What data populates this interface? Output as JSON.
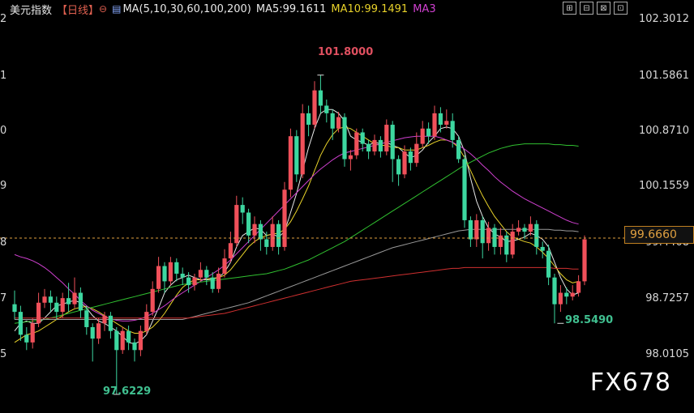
{
  "header": {
    "title": "美元指数",
    "period": "【日线】",
    "ma_label": "MA(5,10,30,60,100,200)",
    "ma5": "MA5:99.1611",
    "ma10": "MA10:99.1491",
    "ma3": "MA3"
  },
  "toolbar": [
    "⊞",
    "⊟",
    "⊠",
    "⊡"
  ],
  "colors": {
    "up": "#f0505a",
    "down": "#3dd7a0",
    "ma5": "#e8e8e8",
    "ma10": "#e8d22a",
    "ma30": "#d040d0",
    "ma60": "#30c030",
    "ma100": "#999999",
    "ma200": "#d03030",
    "current": "#e0a040",
    "high_label": "#e05060",
    "low_label": "#40c090"
  },
  "chart_data": {
    "type": "candlestick",
    "y_ticks": [
      "102.3012",
      "101.5861",
      "100.8710",
      "100.1559",
      "99.4408",
      "98.7257",
      "98.0105"
    ],
    "left_ticks": [
      "2",
      "1",
      "0",
      "9",
      "8",
      "7",
      "5"
    ],
    "current_price": "99.6660",
    "annotations": {
      "high": "101.8000",
      "low_left": "97.6229",
      "low_right": "98.5490"
    },
    "ylim": [
      97.8,
      102.55
    ],
    "candles": [
      [
        98.8,
        98.7,
        98.98,
        98.6
      ],
      [
        98.7,
        98.4,
        98.78,
        98.32
      ],
      [
        98.4,
        98.3,
        98.5,
        98.2
      ],
      [
        98.3,
        98.55,
        98.62,
        98.22
      ],
      [
        98.55,
        98.82,
        98.95,
        98.5
      ],
      [
        98.82,
        98.9,
        99.0,
        98.75
      ],
      [
        98.9,
        98.82,
        98.98,
        98.7
      ],
      [
        98.82,
        98.7,
        98.9,
        98.6
      ],
      [
        98.7,
        98.88,
        98.95,
        98.62
      ],
      [
        98.88,
        98.8,
        99.08,
        98.7
      ],
      [
        98.8,
        98.95,
        99.15,
        98.75
      ],
      [
        98.95,
        98.72,
        99.02,
        98.62
      ],
      [
        98.72,
        98.5,
        98.78,
        98.4
      ],
      [
        98.5,
        98.35,
        98.55,
        98.05
      ],
      [
        98.35,
        98.55,
        98.62,
        98.28
      ],
      [
        98.55,
        98.65,
        98.7,
        98.45
      ],
      [
        98.65,
        98.45,
        98.7,
        98.35
      ],
      [
        98.45,
        98.2,
        98.5,
        97.62
      ],
      [
        98.2,
        98.45,
        98.5,
        98.15
      ],
      [
        98.45,
        98.3,
        98.52,
        98.2
      ],
      [
        98.3,
        98.2,
        98.35,
        98.05
      ],
      [
        98.2,
        98.45,
        98.52,
        98.12
      ],
      [
        98.45,
        98.7,
        98.8,
        98.4
      ],
      [
        98.7,
        99.0,
        99.1,
        98.65
      ],
      [
        99.0,
        99.3,
        99.42,
        98.95
      ],
      [
        99.3,
        99.1,
        99.35,
        98.95
      ],
      [
        99.1,
        99.35,
        99.42,
        99.05
      ],
      [
        99.35,
        99.2,
        99.4,
        99.1
      ],
      [
        99.2,
        99.15,
        99.28,
        99.05
      ],
      [
        99.15,
        99.05,
        99.22,
        98.95
      ],
      [
        99.05,
        99.15,
        99.2,
        98.98
      ],
      [
        99.15,
        99.25,
        99.35,
        99.1
      ],
      [
        99.25,
        99.15,
        99.3,
        99.05
      ],
      [
        99.15,
        99.0,
        99.22,
        98.95
      ],
      [
        99.0,
        99.2,
        99.28,
        98.95
      ],
      [
        99.2,
        99.4,
        99.52,
        99.15
      ],
      [
        99.4,
        99.6,
        99.75,
        99.35
      ],
      [
        99.6,
        100.1,
        100.22,
        99.55
      ],
      [
        100.1,
        100.0,
        100.2,
        99.85
      ],
      [
        100.0,
        99.7,
        100.05,
        99.6
      ],
      [
        99.7,
        99.85,
        99.95,
        99.6
      ],
      [
        99.85,
        99.65,
        99.9,
        99.5
      ],
      [
        99.65,
        99.55,
        99.75,
        99.45
      ],
      [
        99.55,
        99.85,
        99.95,
        99.5
      ],
      [
        99.85,
        99.55,
        99.9,
        99.45
      ],
      [
        99.55,
        100.3,
        100.4,
        99.5
      ],
      [
        100.3,
        101.0,
        101.1,
        100.2
      ],
      [
        101.0,
        100.5,
        101.08,
        100.4
      ],
      [
        100.5,
        101.3,
        101.42,
        100.45
      ],
      [
        101.3,
        101.15,
        101.4,
        101.0
      ],
      [
        101.15,
        101.6,
        101.72,
        101.1
      ],
      [
        101.6,
        101.4,
        101.8,
        101.3
      ],
      [
        101.4,
        101.3,
        101.48,
        101.18
      ],
      [
        101.3,
        101.1,
        101.35,
        100.95
      ],
      [
        101.1,
        101.25,
        101.32,
        101.05
      ],
      [
        101.25,
        100.7,
        101.3,
        100.6
      ],
      [
        100.7,
        100.75,
        100.82,
        100.55
      ],
      [
        100.75,
        101.05,
        101.1,
        100.7
      ],
      [
        101.05,
        100.9,
        101.1,
        100.8
      ],
      [
        100.9,
        100.8,
        100.95,
        100.7
      ],
      [
        100.8,
        100.95,
        101.02,
        100.75
      ],
      [
        100.95,
        100.8,
        101.0,
        100.72
      ],
      [
        100.8,
        101.15,
        101.22,
        100.75
      ],
      [
        101.15,
        100.7,
        101.2,
        100.4
      ],
      [
        100.7,
        100.5,
        100.75,
        100.35
      ],
      [
        100.5,
        100.8,
        100.88,
        100.45
      ],
      [
        100.8,
        100.65,
        100.85,
        100.55
      ],
      [
        100.65,
        100.9,
        101.05,
        100.6
      ],
      [
        100.9,
        101.1,
        101.2,
        100.85
      ],
      [
        101.1,
        101.0,
        101.18,
        100.9
      ],
      [
        101.0,
        101.3,
        101.4,
        100.95
      ],
      [
        101.3,
        101.15,
        101.38,
        101.05
      ],
      [
        101.15,
        101.2,
        101.35,
        101.1
      ],
      [
        101.2,
        100.95,
        101.3,
        100.85
      ],
      [
        100.95,
        100.7,
        101.0,
        100.65
      ],
      [
        100.7,
        99.9,
        100.75,
        99.8
      ],
      [
        99.9,
        99.65,
        99.95,
        99.55
      ],
      [
        99.65,
        99.9,
        99.98,
        99.55
      ],
      [
        99.9,
        99.6,
        99.95,
        99.4
      ],
      [
        99.6,
        99.8,
        99.88,
        99.5
      ],
      [
        99.8,
        99.55,
        99.85,
        99.45
      ],
      [
        99.55,
        99.7,
        99.8,
        99.45
      ],
      [
        99.7,
        99.45,
        99.75,
        99.35
      ],
      [
        99.45,
        99.75,
        99.85,
        99.4
      ],
      [
        99.75,
        99.8,
        99.9,
        99.7
      ],
      [
        99.8,
        99.75,
        99.85,
        99.65
      ],
      [
        99.75,
        99.85,
        99.95,
        99.7
      ],
      [
        99.85,
        99.55,
        99.9,
        99.45
      ],
      [
        99.55,
        99.5,
        99.62,
        99.4
      ],
      [
        99.5,
        99.15,
        99.58,
        99.05
      ],
      [
        99.15,
        98.8,
        99.2,
        98.55
      ],
      [
        98.8,
        98.95,
        99.05,
        98.7
      ],
      [
        98.95,
        98.9,
        99.02,
        98.8
      ],
      [
        98.9,
        98.95,
        99.05,
        98.85
      ],
      [
        98.95,
        99.1,
        99.18,
        98.9
      ],
      [
        99.1,
        99.65,
        99.7,
        99.05
      ]
    ],
    "ma_lines": [
      {
        "name": "MA5",
        "color": "#e8e8e8",
        "values": [
          98.45,
          98.55,
          98.58,
          98.55,
          98.55,
          98.62,
          98.7,
          98.78,
          98.8,
          98.83,
          98.85,
          98.82,
          98.75,
          98.65,
          98.58,
          98.55,
          98.5,
          98.45,
          98.38,
          98.3,
          98.28,
          98.32,
          98.4,
          98.58,
          98.75,
          98.95,
          99.05,
          99.12,
          99.15,
          99.18,
          99.15,
          99.12,
          99.12,
          99.13,
          99.15,
          99.22,
          99.35,
          99.55,
          99.7,
          99.75,
          99.8,
          99.78,
          99.7,
          99.72,
          99.68,
          99.75,
          100.0,
          100.25,
          100.55,
          100.85,
          101.1,
          101.3,
          101.35,
          101.35,
          101.3,
          101.2,
          101.0,
          100.95,
          100.92,
          100.88,
          100.92,
          100.9,
          100.92,
          100.88,
          100.85,
          100.78,
          100.72,
          100.75,
          100.82,
          100.92,
          101.0,
          101.1,
          101.12,
          101.1,
          101.0,
          100.8,
          100.45,
          100.15,
          99.95,
          99.8,
          99.72,
          99.68,
          99.62,
          99.63,
          99.65,
          99.68,
          99.73,
          99.7,
          99.65,
          99.55,
          99.35,
          99.15,
          99.0,
          98.92,
          98.95
        ]
      },
      {
        "name": "MA10",
        "color": "#e8d22a",
        "values": [
          98.3,
          98.35,
          98.4,
          98.42,
          98.45,
          98.5,
          98.55,
          98.6,
          98.65,
          98.7,
          98.74,
          98.76,
          98.77,
          98.74,
          98.7,
          98.65,
          98.6,
          98.55,
          98.5,
          98.45,
          98.42,
          98.42,
          98.45,
          98.5,
          98.58,
          98.68,
          98.8,
          98.92,
          99.02,
          99.08,
          99.12,
          99.12,
          99.13,
          99.14,
          99.15,
          99.18,
          99.25,
          99.35,
          99.45,
          99.55,
          99.62,
          99.67,
          99.7,
          99.72,
          99.73,
          99.78,
          99.88,
          100.02,
          100.18,
          100.35,
          100.55,
          100.75,
          100.9,
          101.02,
          101.1,
          101.12,
          101.1,
          101.05,
          101.0,
          100.95,
          100.9,
          100.88,
          100.88,
          100.85,
          100.85,
          100.82,
          100.82,
          100.82,
          100.85,
          100.88,
          100.92,
          100.95,
          100.95,
          100.92,
          100.85,
          100.72,
          100.55,
          100.38,
          100.22,
          100.08,
          99.95,
          99.85,
          99.75,
          99.68,
          99.65,
          99.62,
          99.6,
          99.55,
          99.48,
          99.4,
          99.3,
          99.2,
          99.12,
          99.08,
          99.1
        ]
      },
      {
        "name": "MA30",
        "color": "#d040d0",
        "values": [
          99.45,
          99.42,
          99.4,
          99.37,
          99.33,
          99.28,
          99.22,
          99.15,
          99.08,
          99.0,
          98.93,
          98.85,
          98.78,
          98.72,
          98.68,
          98.64,
          98.61,
          98.59,
          98.58,
          98.58,
          98.59,
          98.61,
          98.64,
          98.68,
          98.73,
          98.78,
          98.84,
          98.9,
          98.95,
          99.0,
          99.05,
          99.1,
          99.15,
          99.2,
          99.25,
          99.31,
          99.38,
          99.46,
          99.54,
          99.62,
          99.7,
          99.78,
          99.86,
          99.94,
          100.02,
          100.1,
          100.18,
          100.26,
          100.34,
          100.42,
          100.5,
          100.57,
          100.63,
          100.69,
          100.74,
          100.78,
          100.8,
          100.82,
          100.84,
          100.86,
          100.88,
          100.9,
          100.92,
          100.94,
          100.96,
          100.98,
          100.99,
          101.0,
          101.0,
          101.0,
          101.0,
          100.98,
          100.95,
          100.92,
          100.88,
          100.83,
          100.77,
          100.7,
          100.62,
          100.55,
          100.47,
          100.4,
          100.34,
          100.28,
          100.23,
          100.18,
          100.14,
          100.1,
          100.06,
          100.02,
          99.98,
          99.94,
          99.9,
          99.87,
          99.85
        ]
      },
      {
        "name": "MA60",
        "color": "#30c030",
        "values": [
          98.55,
          98.56,
          98.57,
          98.58,
          98.59,
          98.6,
          98.62,
          98.64,
          98.66,
          98.68,
          98.7,
          98.72,
          98.74,
          98.76,
          98.78,
          98.8,
          98.82,
          98.84,
          98.86,
          98.88,
          98.9,
          98.92,
          98.94,
          98.96,
          98.98,
          99.0,
          99.02,
          99.04,
          99.06,
          99.07,
          99.08,
          99.09,
          99.1,
          99.11,
          99.12,
          99.13,
          99.14,
          99.15,
          99.16,
          99.17,
          99.18,
          99.19,
          99.2,
          99.22,
          99.24,
          99.26,
          99.29,
          99.32,
          99.35,
          99.38,
          99.42,
          99.46,
          99.5,
          99.54,
          99.58,
          99.62,
          99.67,
          99.72,
          99.77,
          99.82,
          99.87,
          99.92,
          99.97,
          100.02,
          100.07,
          100.12,
          100.17,
          100.22,
          100.27,
          100.32,
          100.37,
          100.42,
          100.47,
          100.52,
          100.57,
          100.62,
          100.66,
          100.7,
          100.74,
          100.78,
          100.81,
          100.84,
          100.86,
          100.88,
          100.89,
          100.9,
          100.9,
          100.9,
          100.9,
          100.9,
          100.89,
          100.89,
          100.88,
          100.88,
          100.87
        ]
      },
      {
        "name": "MA100",
        "color": "#999999",
        "values": [
          98.6,
          98.6,
          98.6,
          98.6,
          98.6,
          98.6,
          98.6,
          98.6,
          98.6,
          98.6,
          98.6,
          98.6,
          98.6,
          98.6,
          98.6,
          98.6,
          98.6,
          98.6,
          98.6,
          98.6,
          98.6,
          98.6,
          98.6,
          98.6,
          98.6,
          98.6,
          98.6,
          98.6,
          98.6,
          98.62,
          98.64,
          98.66,
          98.68,
          98.7,
          98.72,
          98.74,
          98.76,
          98.78,
          98.8,
          98.82,
          98.85,
          98.88,
          98.91,
          98.94,
          98.97,
          99.0,
          99.03,
          99.06,
          99.09,
          99.12,
          99.15,
          99.18,
          99.21,
          99.24,
          99.27,
          99.3,
          99.33,
          99.36,
          99.39,
          99.42,
          99.45,
          99.48,
          99.51,
          99.54,
          99.56,
          99.58,
          99.6,
          99.62,
          99.64,
          99.66,
          99.68,
          99.7,
          99.72,
          99.74,
          99.76,
          99.77,
          99.78,
          99.78,
          99.78,
          99.78,
          99.78,
          99.78,
          99.78,
          99.78,
          99.78,
          99.78,
          99.78,
          99.78,
          99.78,
          99.78,
          99.77,
          99.77,
          99.76,
          99.76,
          99.75
        ]
      },
      {
        "name": "MA200",
        "color": "#d03030",
        "values": [
          98.62,
          98.62,
          98.62,
          98.62,
          98.62,
          98.62,
          98.62,
          98.62,
          98.62,
          98.62,
          98.62,
          98.62,
          98.62,
          98.62,
          98.62,
          98.62,
          98.62,
          98.62,
          98.62,
          98.62,
          98.62,
          98.62,
          98.62,
          98.62,
          98.62,
          98.62,
          98.62,
          98.62,
          98.62,
          98.62,
          98.63,
          98.64,
          98.65,
          98.66,
          98.67,
          98.68,
          98.7,
          98.72,
          98.74,
          98.76,
          98.78,
          98.8,
          98.82,
          98.84,
          98.86,
          98.88,
          98.9,
          98.92,
          98.94,
          98.96,
          98.98,
          99.0,
          99.02,
          99.04,
          99.06,
          99.08,
          99.1,
          99.11,
          99.12,
          99.13,
          99.14,
          99.15,
          99.16,
          99.17,
          99.18,
          99.19,
          99.2,
          99.21,
          99.22,
          99.23,
          99.24,
          99.25,
          99.26,
          99.27,
          99.27,
          99.28,
          99.28,
          99.28,
          99.28,
          99.28,
          99.28,
          99.28,
          99.28,
          99.28,
          99.28,
          99.28,
          99.28,
          99.28,
          99.28,
          99.28,
          99.27,
          99.27,
          99.27,
          99.26,
          99.26
        ]
      }
    ]
  },
  "watermark": "FX678"
}
